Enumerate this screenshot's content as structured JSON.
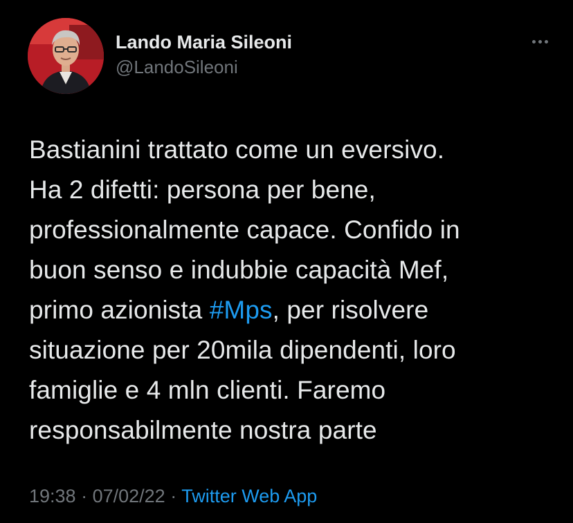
{
  "author": {
    "display_name": "Lando Maria Sileoni",
    "handle": "@LandoSileoni",
    "avatar_icon": "profile-photo"
  },
  "more_icon": "more-horizontal-icon",
  "tweet": {
    "lines": [
      [
        {
          "text": "Bastianini trattato come un eversivo."
        }
      ],
      [
        {
          "text": "Ha 2 difetti: persona per bene,"
        }
      ],
      [
        {
          "text": "professionalmente capace. Confido in"
        }
      ],
      [
        {
          "text": "buon senso e indubbie capacità Mef,"
        }
      ],
      [
        {
          "text": "primo azionista "
        },
        {
          "text": "#Mps",
          "hashtag": true
        },
        {
          "text": ", per risolvere"
        }
      ],
      [
        {
          "text": "situazione per 20mila dipendenti, loro"
        }
      ],
      [
        {
          "text": "famiglie e 4 mln clienti. Faremo"
        }
      ],
      [
        {
          "text": "responsabilmente nostra parte"
        }
      ]
    ]
  },
  "meta": {
    "time": "19:38",
    "separator1": " · ",
    "date": "07/02/22",
    "separator2": " · ",
    "source": "Twitter Web App"
  },
  "colors": {
    "background": "#000000",
    "text": "#e7e9ea",
    "secondary": "#71767b",
    "accent": "#1d9bf0"
  }
}
